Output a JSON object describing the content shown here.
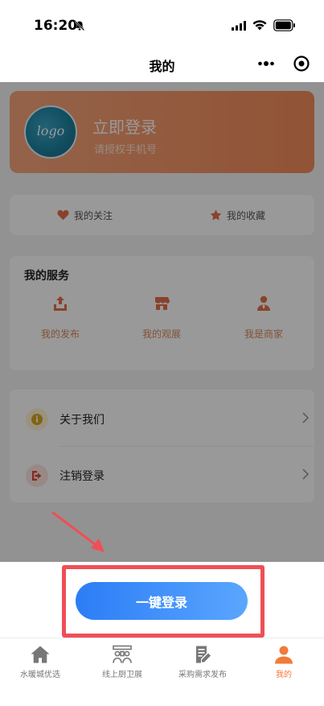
{
  "status_bar": {
    "time": "16:20"
  },
  "nav": {
    "title": "我的"
  },
  "profile": {
    "logo_text": "logo",
    "login_title": "立即登录",
    "login_subtitle": "请授权手机号"
  },
  "favorites": {
    "follow": "我的关注",
    "collect": "我的收藏"
  },
  "services": {
    "title": "我的服务",
    "items": [
      {
        "label": "我的发布",
        "icon": "upload-icon"
      },
      {
        "label": "我的观展",
        "icon": "shop-icon"
      },
      {
        "label": "我是商家",
        "icon": "merchant-icon"
      }
    ]
  },
  "menu": {
    "items": [
      {
        "label": "关于我们",
        "icon": "info-icon"
      },
      {
        "label": "注销登录",
        "icon": "logout-icon"
      }
    ]
  },
  "sheet": {
    "login_button": "一键登录"
  },
  "tabbar": {
    "items": [
      {
        "label": "水暖城优选",
        "icon": "home-icon"
      },
      {
        "label": "线上厨卫展",
        "icon": "exhibition-icon"
      },
      {
        "label": "采购需求发布",
        "icon": "edit-icon"
      },
      {
        "label": "我的",
        "icon": "user-icon"
      }
    ]
  },
  "colors": {
    "accent": "#f27a3a",
    "button_blue": "#2c7cf6",
    "highlight_red": "#ef4f56"
  }
}
